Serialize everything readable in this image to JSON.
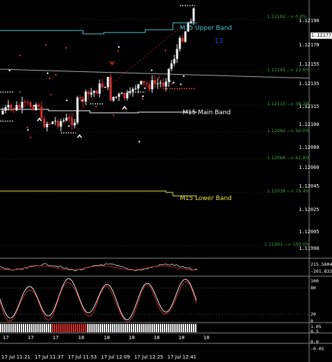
{
  "price_axis": {
    "ticks": [
      "1.12190",
      "1.12177",
      "1.12170",
      "1.12155",
      "1.12135",
      "1.12115",
      "1.12100",
      "1.12080",
      "1.12060",
      "1.12045",
      "1.12025",
      "1.12005",
      "1.11990"
    ],
    "current_price": "1.12177"
  },
  "fib_levels": [
    {
      "label": "1.12192 --> 0.0%"
    },
    {
      "label": "1.12145 --> 23.6%"
    },
    {
      "label": "1.12115 --> 38.2%"
    },
    {
      "label": "1.12092 --> 50.0%"
    },
    {
      "label": "1.12068 --> 61.8%"
    },
    {
      "label": "1.12038 --> 76.4%"
    },
    {
      "label": "1.11991 --> 100.0%"
    }
  ],
  "bands": {
    "upper": {
      "label": "M15 Upper Band",
      "color": "#4fc9d6"
    },
    "main": {
      "label": "M15 Main Band",
      "color": "#ffffff"
    },
    "lower": {
      "label": "M15 Lower Band",
      "color": "#e6e64a"
    }
  },
  "counter": "13",
  "indicator1": {
    "ticks": [
      "215.5804",
      "-201.832"
    ]
  },
  "indicator2": {
    "ticks": [
      "100",
      "80",
      "20",
      "0"
    ]
  },
  "indicator3": {
    "ticks": [
      "1.05",
      "0.5",
      "0.0",
      "-0.05"
    ]
  },
  "x_day_labels": [
    "17",
    "17",
    "17",
    "18",
    "18",
    "18",
    "18",
    "18",
    "18"
  ],
  "time_labels": [
    "17 Jul 11:21",
    "17 Jul 11:37",
    "17 Jul 11:53",
    "17 Jul 12:09",
    "17 Jul 12:25",
    "17 Jul 12:41"
  ],
  "colors": {
    "bull": "#ffffff",
    "bear": "#d93030",
    "grid": "#6b6b6b",
    "fib": "#3ca63c"
  }
}
